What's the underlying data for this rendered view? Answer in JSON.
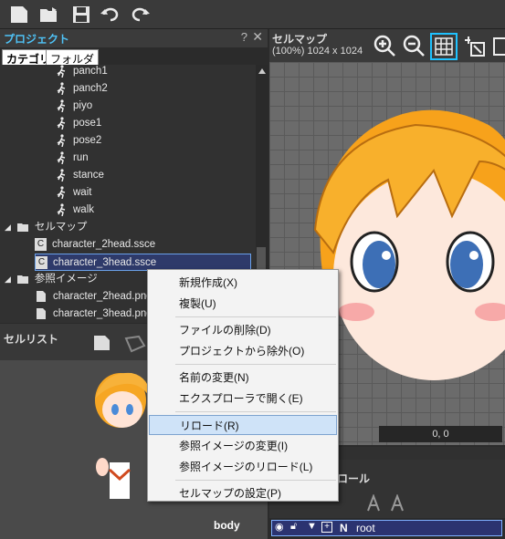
{
  "toolbar": {
    "icons": [
      "new-file-icon",
      "open-folder-icon",
      "save-icon",
      "undo-icon",
      "redo-icon"
    ]
  },
  "project_panel": {
    "title": "プロジェクト",
    "help": "?",
    "close": "✕",
    "tabs": [
      {
        "label": "カテゴリ"
      },
      {
        "label": "フォルダ"
      }
    ]
  },
  "tree": {
    "animations": [
      "panch1",
      "panch2",
      "piyo",
      "pose1",
      "pose2",
      "run",
      "stance",
      "wait",
      "walk"
    ],
    "cellmap_folder": "セルマップ",
    "cellmaps": [
      "character_2head.ssce",
      "character_3head.ssce"
    ],
    "ref_folder": "参照イメージ",
    "refs": [
      "character_2head.png",
      "character_3head.png"
    ],
    "cellmap_badge": "C"
  },
  "cell_list": {
    "title": "セルリスト",
    "label": "body"
  },
  "cellmap_view": {
    "title": "セルマップ",
    "info": "(100%) 1024 x 1024",
    "coord": "0, 0"
  },
  "parts_panel": {
    "title_partial": "ロール",
    "row": {
      "flag": "N",
      "name": "root"
    }
  },
  "context_menu": {
    "groups": [
      [
        "新規作成(X)",
        "複製(U)"
      ],
      [
        "ファイルの削除(D)",
        "プロジェクトから除外(O)"
      ],
      [
        "名前の変更(N)",
        "エクスプローラで開く(E)"
      ],
      [
        "リロード(R)",
        "参照イメージの変更(I)",
        "参照イメージのリロード(L)"
      ],
      [
        "セルマップの設定(P)"
      ]
    ],
    "highlighted": "リロード(R)"
  },
  "colors": {
    "accent": "#4fc3f7",
    "selection": "#2e3a6a",
    "menu_bg": "#f3f3f3"
  }
}
